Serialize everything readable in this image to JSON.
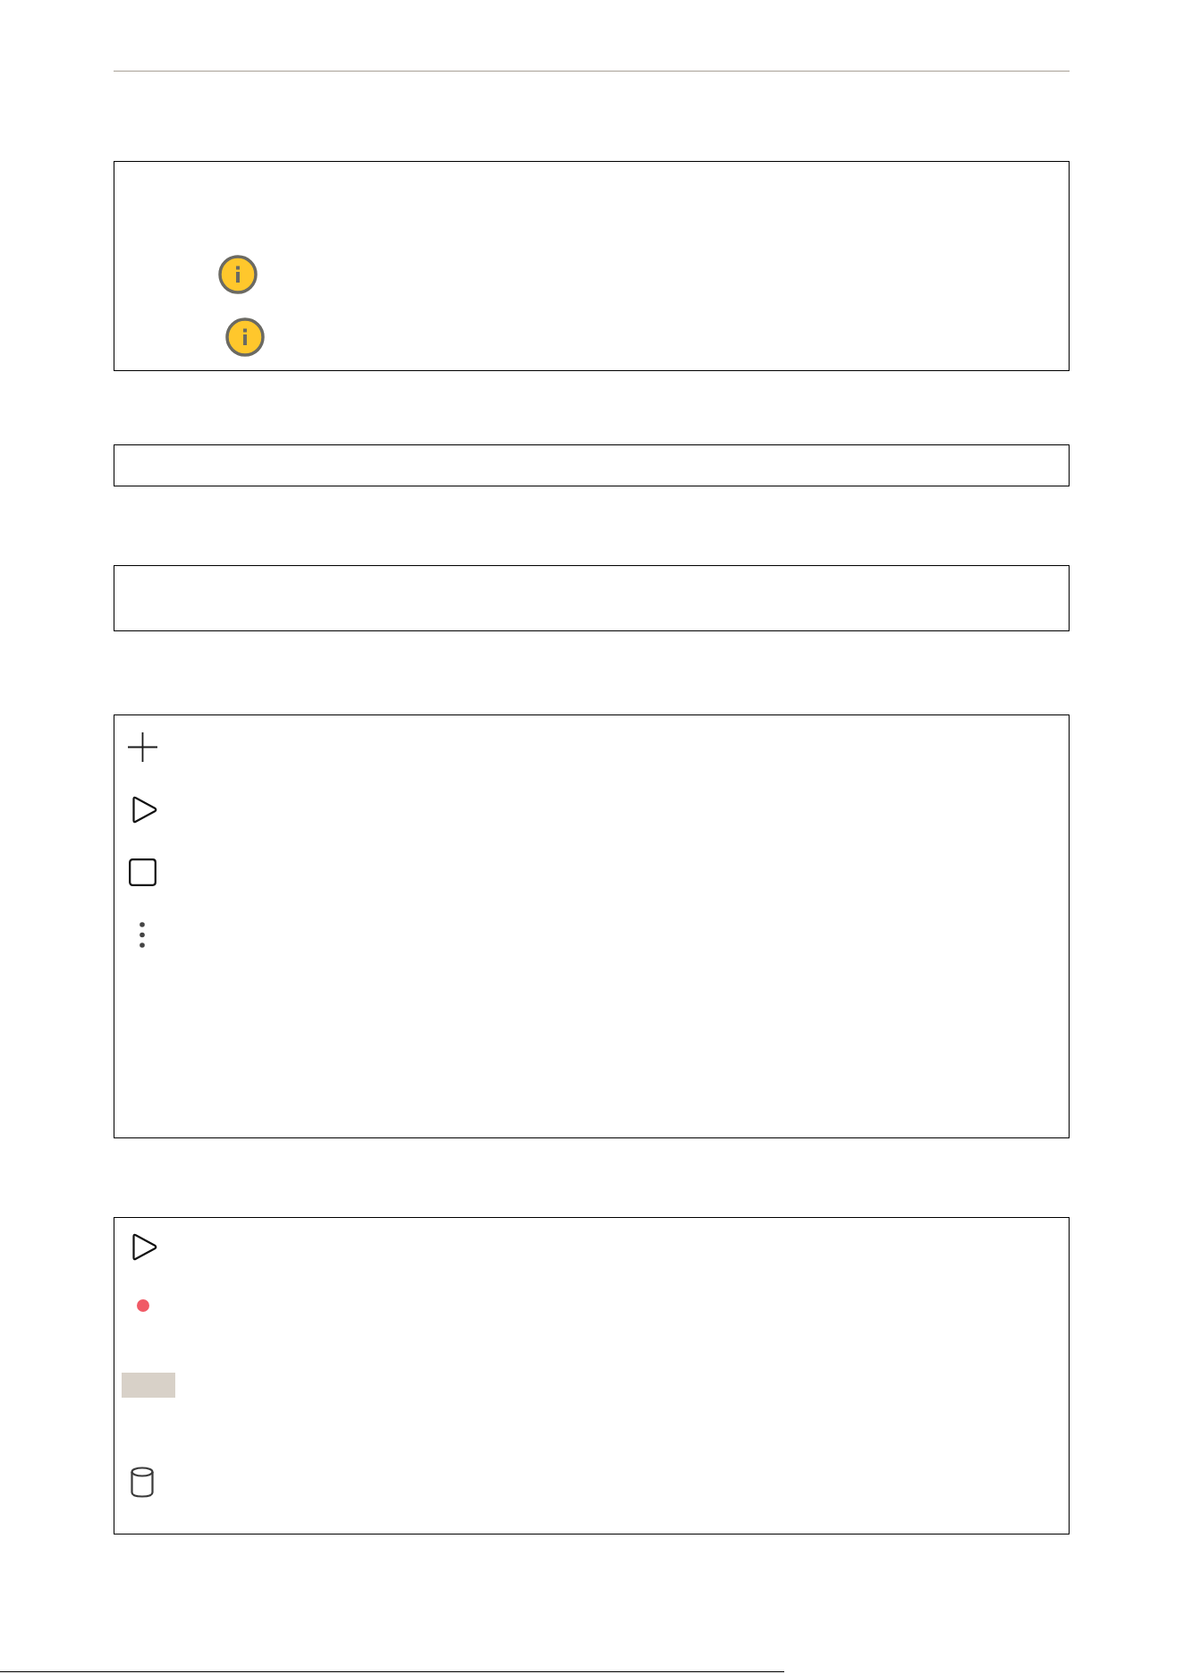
{
  "sections": [
    {
      "kind": "notice",
      "icons": [
        {
          "kind": "info"
        },
        {
          "kind": "info"
        }
      ]
    },
    {
      "kind": "line"
    },
    {
      "kind": "block"
    },
    {
      "kind": "icon-list",
      "icons": [
        {
          "kind": "plus"
        },
        {
          "kind": "play"
        },
        {
          "kind": "stop"
        },
        {
          "kind": "more"
        }
      ]
    },
    {
      "kind": "icon-list",
      "icons": [
        {
          "kind": "play"
        },
        {
          "kind": "record"
        },
        {
          "kind": "swatch"
        },
        {
          "kind": "storage"
        }
      ]
    }
  ]
}
